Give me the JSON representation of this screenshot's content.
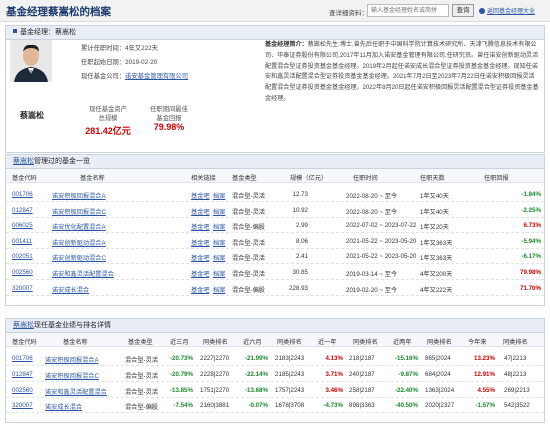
{
  "header": {
    "title": "基金经理蔡嵩松的档案",
    "query_label": "查详细资料：",
    "search_placeholder": "输入基金经理姓名或简拼",
    "search_btn": "查询",
    "back_link": "返回基金经理大全"
  },
  "profile": {
    "section_title": "基金经理：蔡嵩松",
    "name": "蔡嵩松",
    "tenure": "累计任职时间：4年又222天",
    "start_date": "任职起始日期：2019-02-20",
    "company_label": "现任基金公司：",
    "company": "诺安基金管理有限公司",
    "aum_label1": "现任基金资产",
    "aum_label2": "总规模",
    "aum": "281.42亿元",
    "best_label1": "任职期间最佳",
    "best_label2": "基金回报",
    "best": "79.98%",
    "bio_label": "基金经理简介：",
    "bio": "蔡嵩松先生:博士,曾先后任职于中国科学院计算技术研究所、天津飞腾信息技术有限公司、华泰证券股份有限公司,2017年11月加入诺安基金管理有限公司,任研究员。曾任诺安创新驱动灵活配置混合型证券投资基金基金经理。2019年2月起任诺安成长混合型证券投资基金基金经理。现知任诺安和鑫灵活配置混合型证券投资基金基金经理。2021年7月2日至2023年7月22日任诺安积极回报灵活配置混合型证券投资基金基金经理。2022年8月20日起任诺安积极回报灵活配置混合型证券投资基金基金经理。"
  },
  "managed": {
    "section_link": "蔡嵩松",
    "section_rest": "管理过的基金一览",
    "headers": [
      "基金代码",
      "基金名称",
      "相关链接",
      "基金类型",
      "规模（亿元）",
      "任职时间",
      "任职天数",
      "任职回报"
    ],
    "rows": [
      {
        "code": "001706",
        "name": "诺安积极回报混合A",
        "l1": "基金吧",
        "l2": "档案",
        "type": "混合型-灵活",
        "size": "12.73",
        "period": "2022-08-20 ~ 至今",
        "days": "1年又40天",
        "ret": "-1.84%",
        "c": "green"
      },
      {
        "code": "012847",
        "name": "诺安积极回报混合C",
        "l1": "基金吧",
        "l2": "档案",
        "type": "混合型-灵活",
        "size": "10.92",
        "period": "2022-08-20 ~ 至今",
        "days": "1年又40天",
        "ret": "-2.25%",
        "c": "green"
      },
      {
        "code": "006025",
        "name": "诺安优化配置混合A",
        "l1": "基金吧",
        "l2": "档案",
        "type": "混合型-偏股",
        "size": "2.99",
        "period": "2022-07-02 ~ 2023-07-22",
        "days": "1年又20天",
        "ret": "6.73%",
        "c": "red"
      },
      {
        "code": "001411",
        "name": "诺安创新驱动混合A",
        "l1": "基金吧",
        "l2": "档案",
        "type": "混合型-灵活",
        "size": "8.06",
        "period": "2021-05-22 ~ 2023-05-20",
        "days": "1年又363天",
        "ret": "-5.94%",
        "c": "green"
      },
      {
        "code": "002051",
        "name": "诺安创新驱动混合C",
        "l1": "基金吧",
        "l2": "档案",
        "type": "混合型-灵活",
        "size": "2.41",
        "period": "2021-05-22 ~ 2023-05-20",
        "days": "1年又363天",
        "ret": "-6.17%",
        "c": "green"
      },
      {
        "code": "002560",
        "name": "诺安和鑫灵活配置混合",
        "l1": "基金吧",
        "l2": "档案",
        "type": "混合型-灵活",
        "size": "30.85",
        "period": "2019-03-14 ~ 至今",
        "days": "4年又200天",
        "ret": "79.98%",
        "c": "red"
      },
      {
        "code": "320007",
        "name": "诺安成长混合",
        "l1": "基金吧",
        "l2": "档案",
        "type": "混合型-偏股",
        "size": "228.93",
        "period": "2019-02-20 ~ 至今",
        "days": "4年又222天",
        "ret": "71.70%",
        "c": "red"
      }
    ]
  },
  "current": {
    "section_link": "蔡嵩松",
    "section_rest": "现任基金业绩与排名详情",
    "headers": [
      "基金代码",
      "基金名称",
      "基金类型",
      "近三月",
      "同类排名",
      "近六月",
      "同类排名",
      "近一年",
      "同类排名",
      "近两年",
      "同类排名",
      "今年来",
      "同类排名"
    ],
    "rows": [
      {
        "code": "001706",
        "name": "诺安积极回报混合A",
        "type": "混合型-灵活",
        "m3": "-20.73%",
        "r1": "2227|2270",
        "m6": "-21.99%",
        "r2": "2183|2243",
        "y1": "4.13%",
        "r3": "218|2187",
        "y2": "-15.16%",
        "r4": "865|2024",
        "ytd": "13.23%",
        "r5": "47|2213"
      },
      {
        "code": "012847",
        "name": "诺安积极回报混合C",
        "type": "混合型-灵活",
        "m3": "-20.79%",
        "r1": "2228|2270",
        "m6": "-22.14%",
        "r2": "2185|2243",
        "y1": "3.71%",
        "r3": "240|2187",
        "y2": "-9.87%",
        "r4": "684|2024",
        "ytd": "12.91%",
        "r5": "48|2213"
      },
      {
        "code": "002560",
        "name": "诺安和鑫灵活配置混合",
        "type": "混合型-灵活",
        "m3": "-13.85%",
        "r1": "1751|2270",
        "m6": "-13.68%",
        "r2": "1757|2243",
        "y1": "3.46%",
        "r3": "258|2187",
        "y2": "-22.40%",
        "r4": "1363|2024",
        "ytd": "4.55%",
        "r5": "269|2213"
      },
      {
        "code": "320007",
        "name": "诺安成长混合",
        "type": "混合型-偏股",
        "m3": "-7.54%",
        "r1": "2160|3881",
        "m6": "-0.07%",
        "r2": "1678|3708",
        "y1": "-4.73%",
        "r3": "898|3363",
        "y2": "-40.50%",
        "r4": "2020|2327",
        "ytd": "-1.57%",
        "r5": "542|3522"
      }
    ]
  }
}
